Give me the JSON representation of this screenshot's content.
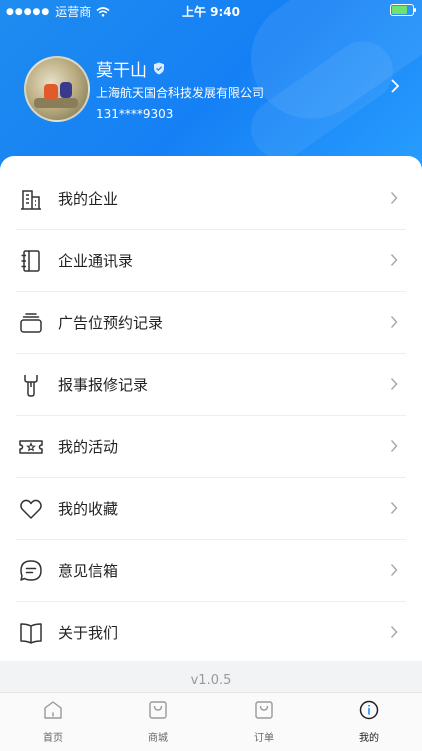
{
  "status_bar": {
    "carrier": "运营商",
    "time": "上午 9:40"
  },
  "profile": {
    "name": "莫干山",
    "company": "上海航天国合科技发展有限公司",
    "phone": "131****9303"
  },
  "menu": {
    "items": [
      {
        "label": "我的企业",
        "icon": "building-icon"
      },
      {
        "label": "企业通讯录",
        "icon": "contacts-book-icon"
      },
      {
        "label": "广告位预约记录",
        "icon": "stack-icon"
      },
      {
        "label": "报事报修记录",
        "icon": "wrench-icon"
      },
      {
        "label": "我的活动",
        "icon": "ticket-icon"
      },
      {
        "label": "我的收藏",
        "icon": "heart-icon"
      },
      {
        "label": "意见信箱",
        "icon": "chat-icon"
      },
      {
        "label": "关于我们",
        "icon": "book-icon"
      }
    ]
  },
  "version": "v1.0.5",
  "tabbar": {
    "tabs": [
      {
        "label": "首页",
        "icon": "home-icon",
        "active": false
      },
      {
        "label": "商城",
        "icon": "shopping-bag-icon",
        "active": false
      },
      {
        "label": "订单",
        "icon": "order-bag-icon",
        "active": false
      },
      {
        "label": "我的",
        "icon": "profile-info-icon",
        "active": true
      }
    ]
  },
  "colors": {
    "header_gradient_start": "#1e8cf0",
    "header_gradient_end": "#2aa0ff",
    "battery": "#6ee36e"
  }
}
